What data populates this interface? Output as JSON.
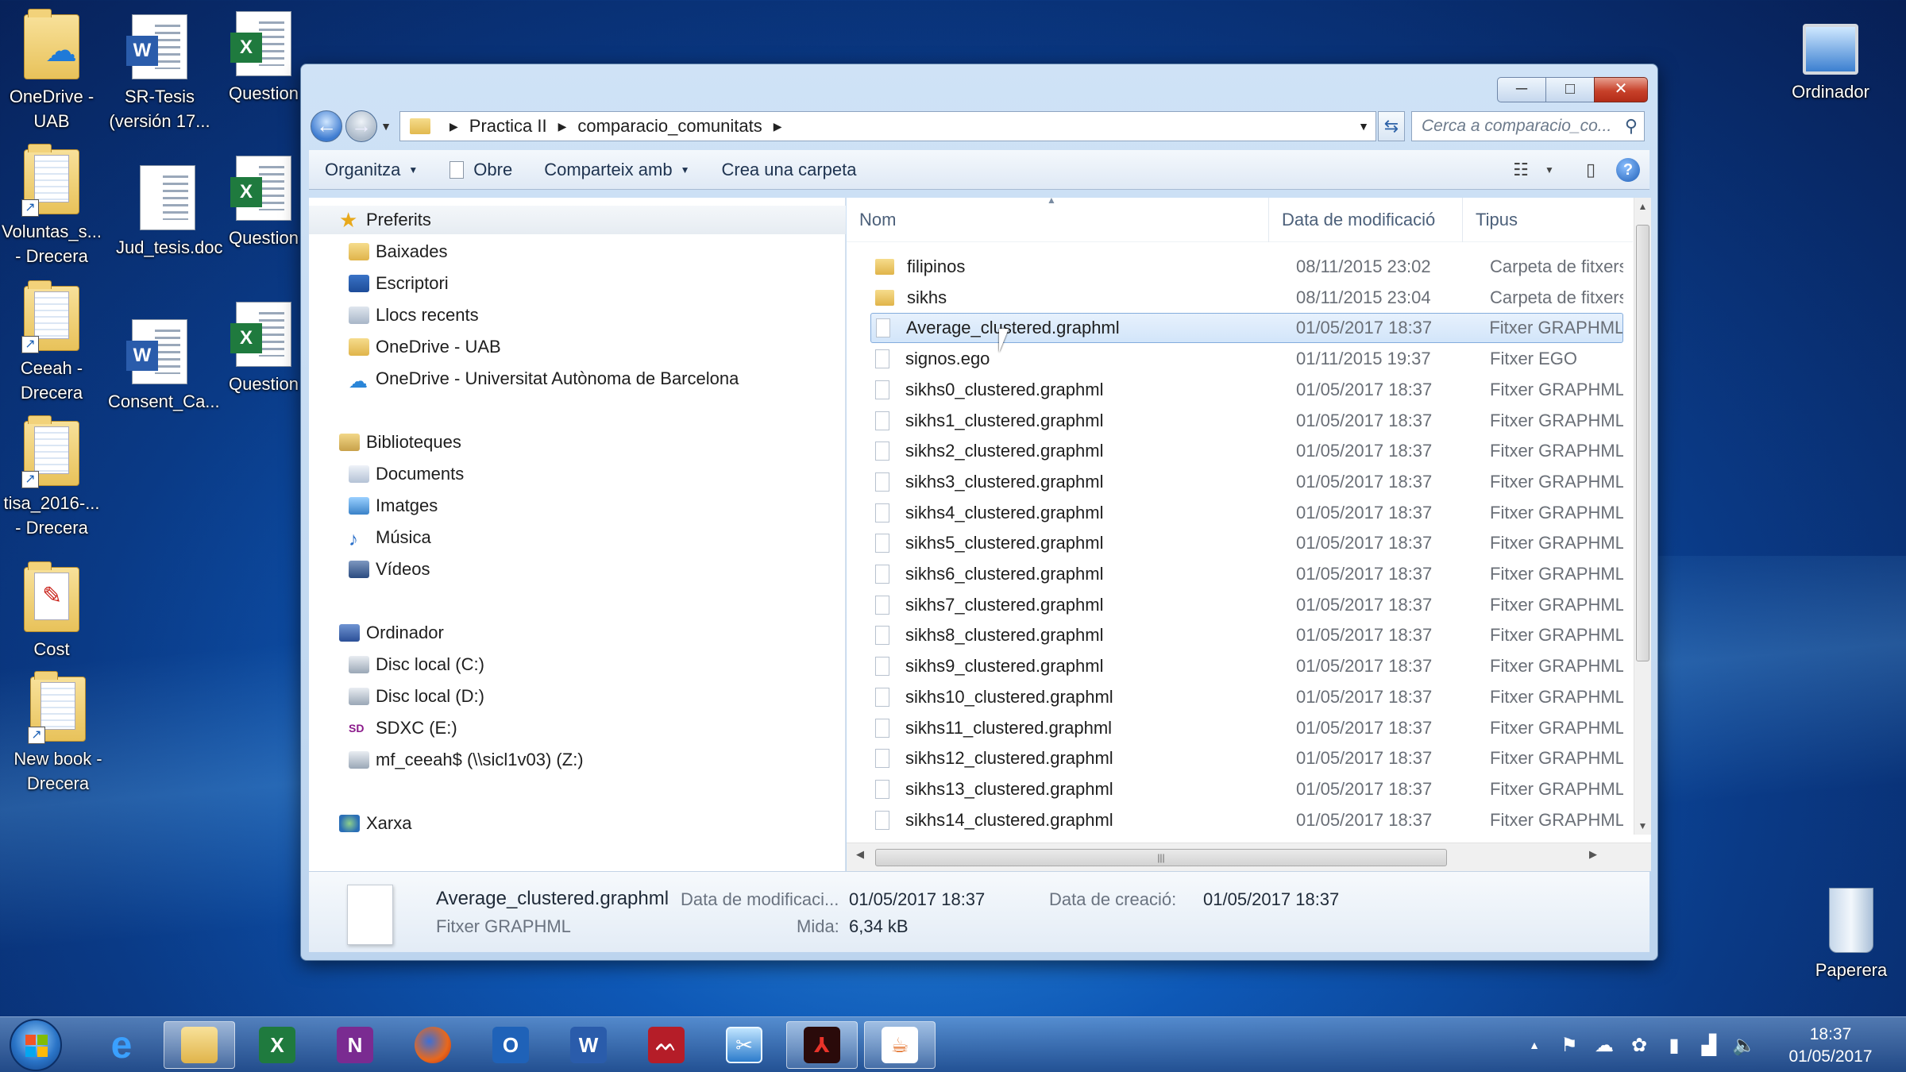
{
  "desktop": {
    "icons": [
      {
        "label": "OneDrive - UAB"
      },
      {
        "label": "SR-Tesis (versión 17..."
      },
      {
        "label": "Question"
      },
      {
        "label": "Voluntas_s... - Drecera"
      },
      {
        "label": "Jud_tesis.doc"
      },
      {
        "label": "Question"
      },
      {
        "label": "Ceeah - Drecera"
      },
      {
        "label": "Consent_Ca..."
      },
      {
        "label": "Question"
      },
      {
        "label": "tisa_2016-... - Drecera"
      },
      {
        "label": "Cost"
      },
      {
        "label": "New book - Drecera"
      },
      {
        "label": "Ordinador"
      },
      {
        "label": "Paperera"
      }
    ]
  },
  "window": {
    "caption_buttons": {
      "minimize": "─",
      "maximize": "□",
      "close": "✕"
    },
    "address": {
      "segments": [
        "Practica II",
        "comparacio_comunitats"
      ],
      "search_placeholder": "Cerca a comparacio_co..."
    },
    "toolbar": {
      "organize": "Organitza",
      "open": "Obre",
      "share": "Comparteix amb",
      "new_folder": "Crea una carpeta"
    },
    "nav": {
      "favorites": "Preferits",
      "downloads": "Baixades",
      "desktop": "Escriptori",
      "recent": "Llocs recents",
      "onedrive_uab": "OneDrive - UAB",
      "onedrive_full": "OneDrive - Universitat Autònoma de Barcelona",
      "libraries": "Biblioteques",
      "documents": "Documents",
      "images": "Imatges",
      "music": "Música",
      "videos": "Vídeos",
      "computer": "Ordinador",
      "disk_c": "Disc local (C:)",
      "disk_d": "Disc local (D:)",
      "sdxc": "SDXC (E:)",
      "network_drive": "mf_ceeah$ (\\\\sicl1v03) (Z:)",
      "network": "Xarxa"
    },
    "columns": {
      "name": "Nom",
      "date": "Data de modificació",
      "type": "Tipus"
    },
    "files": [
      {
        "name": "filipinos",
        "date": "08/11/2015 23:02",
        "type": "Carpeta de fitxers",
        "kind": "folder"
      },
      {
        "name": "sikhs",
        "date": "08/11/2015 23:04",
        "type": "Carpeta de fitxers",
        "kind": "folder"
      },
      {
        "name": "Average_clustered.graphml",
        "date": "01/05/2017 18:37",
        "type": "Fitxer GRAPHML",
        "kind": "file",
        "selected": true
      },
      {
        "name": "signos.ego",
        "date": "01/11/2015 19:37",
        "type": "Fitxer EGO",
        "kind": "file"
      },
      {
        "name": "sikhs0_clustered.graphml",
        "date": "01/05/2017 18:37",
        "type": "Fitxer GRAPHML",
        "kind": "file"
      },
      {
        "name": "sikhs1_clustered.graphml",
        "date": "01/05/2017 18:37",
        "type": "Fitxer GRAPHML",
        "kind": "file"
      },
      {
        "name": "sikhs2_clustered.graphml",
        "date": "01/05/2017 18:37",
        "type": "Fitxer GRAPHML",
        "kind": "file"
      },
      {
        "name": "sikhs3_clustered.graphml",
        "date": "01/05/2017 18:37",
        "type": "Fitxer GRAPHML",
        "kind": "file"
      },
      {
        "name": "sikhs4_clustered.graphml",
        "date": "01/05/2017 18:37",
        "type": "Fitxer GRAPHML",
        "kind": "file"
      },
      {
        "name": "sikhs5_clustered.graphml",
        "date": "01/05/2017 18:37",
        "type": "Fitxer GRAPHML",
        "kind": "file"
      },
      {
        "name": "sikhs6_clustered.graphml",
        "date": "01/05/2017 18:37",
        "type": "Fitxer GRAPHML",
        "kind": "file"
      },
      {
        "name": "sikhs7_clustered.graphml",
        "date": "01/05/2017 18:37",
        "type": "Fitxer GRAPHML",
        "kind": "file"
      },
      {
        "name": "sikhs8_clustered.graphml",
        "date": "01/05/2017 18:37",
        "type": "Fitxer GRAPHML",
        "kind": "file"
      },
      {
        "name": "sikhs9_clustered.graphml",
        "date": "01/05/2017 18:37",
        "type": "Fitxer GRAPHML",
        "kind": "file"
      },
      {
        "name": "sikhs10_clustered.graphml",
        "date": "01/05/2017 18:37",
        "type": "Fitxer GRAPHML",
        "kind": "file"
      },
      {
        "name": "sikhs11_clustered.graphml",
        "date": "01/05/2017 18:37",
        "type": "Fitxer GRAPHML",
        "kind": "file"
      },
      {
        "name": "sikhs12_clustered.graphml",
        "date": "01/05/2017 18:37",
        "type": "Fitxer GRAPHML",
        "kind": "file"
      },
      {
        "name": "sikhs13_clustered.graphml",
        "date": "01/05/2017 18:37",
        "type": "Fitxer GRAPHML",
        "kind": "file"
      },
      {
        "name": "sikhs14_clustered.graphml",
        "date": "01/05/2017 18:37",
        "type": "Fitxer GRAPHML",
        "kind": "file"
      }
    ],
    "details": {
      "name": "Average_clustered.graphml",
      "type": "Fitxer GRAPHML",
      "modified_label": "Data de modificaci...",
      "modified_value": "01/05/2017 18:37",
      "created_label": "Data de creació:",
      "created_value": "01/05/2017 18:37",
      "size_label": "Mida:",
      "size_value": "6,34 kB"
    }
  },
  "taskbar": {
    "apps": [
      "internet-explorer",
      "file-explorer",
      "excel",
      "onenote",
      "firefox",
      "outlook",
      "word",
      "mendeley",
      "snipping-tool",
      "acrobat",
      "java"
    ],
    "clock": {
      "time": "18:37",
      "date": "01/05/2017"
    }
  }
}
